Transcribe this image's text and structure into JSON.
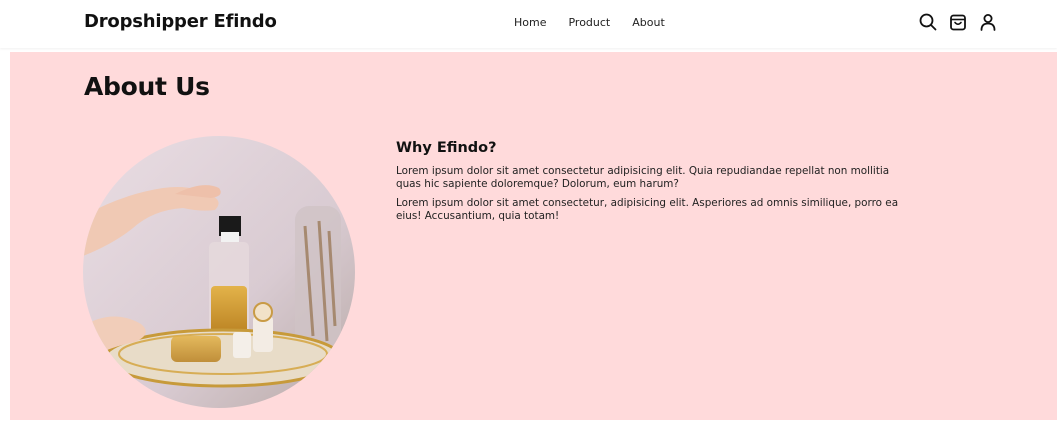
{
  "header": {
    "brand": "Dropshipper Efindo",
    "nav": [
      {
        "label": "Home"
      },
      {
        "label": "Product"
      },
      {
        "label": "About"
      }
    ],
    "icons": [
      "search-icon",
      "shopping-bag-icon",
      "user-icon"
    ]
  },
  "about": {
    "title": "About Us",
    "heading": "Why Efindo?",
    "paragraphs": [
      "Lorem ipsum dolor sit amet consectetur adipisicing elit. Quia repudiandae repellat non mollitia quas hic sapiente doloremque? Dolorum, eum harum?",
      "Lorem ipsum dolor sit amet consectetur, adipisicing elit. Asperiores ad omnis similique, porro ea eius! Accusantium, quia totam!"
    ]
  },
  "colors": {
    "section_background": "#ffdadb",
    "header_background": "#ffffff",
    "text": "#111111"
  }
}
